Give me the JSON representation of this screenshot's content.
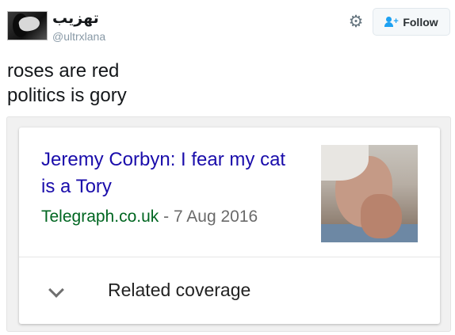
{
  "tweet": {
    "display_name": "تهزيب",
    "handle": "@ultrxlana",
    "follow_label": "Follow",
    "text_lines": [
      "roses are red",
      "politics is gory"
    ],
    "icons": {
      "settings": "gear-icon",
      "follow": "add-person-icon",
      "expand": "chevron-down-icon"
    }
  },
  "card": {
    "headline": "Jeremy Corbyn: I fear my cat is a Tory",
    "source": "Telegraph.co.uk",
    "separator": " - ",
    "date": "7 Aug 2016",
    "related_label": "Related coverage"
  },
  "colors": {
    "headline": "#1a0dab",
    "source": "#006621",
    "follow_icon": "#1da1f2"
  }
}
